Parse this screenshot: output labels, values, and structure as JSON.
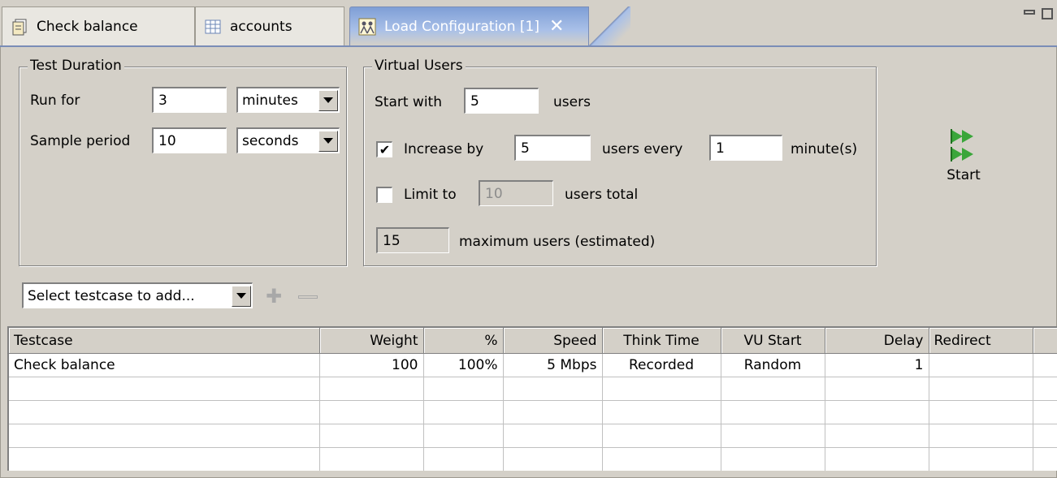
{
  "tabs": [
    {
      "label": "Check balance",
      "icon": "document-stack-icon"
    },
    {
      "label": "accounts",
      "icon": "table-grid-icon"
    },
    {
      "label": "Load Configuration [1]",
      "icon": "users-group-icon",
      "active": true
    }
  ],
  "test_duration": {
    "title": "Test Duration",
    "run_for_label": "Run for",
    "run_for_value": "3",
    "run_for_unit": "minutes",
    "sample_period_label": "Sample period",
    "sample_period_value": "10",
    "sample_period_unit": "seconds"
  },
  "virtual_users": {
    "title": "Virtual Users",
    "start_with_label": "Start with",
    "start_with_value": "5",
    "start_with_suffix": "users",
    "increase_checked": true,
    "increase_label": "Increase by",
    "increase_value": "5",
    "increase_mid": "users every",
    "increase_interval": "1",
    "increase_suffix": "minute(s)",
    "limit_checked": false,
    "limit_label": "Limit to",
    "limit_value": "10",
    "limit_suffix": "users total",
    "max_value": "15",
    "max_suffix": "maximum users (estimated)"
  },
  "start_button": {
    "label": "Start",
    "icon": "run-start-icon"
  },
  "testcase_select": {
    "placeholder": "Select testcase to add..."
  },
  "table": {
    "columns": [
      "Testcase",
      "Weight",
      "%",
      "Speed",
      "Think Time",
      "VU Start",
      "Delay",
      "Redirect"
    ],
    "rows": [
      [
        "Check balance",
        "100",
        "100%",
        "5 Mbps",
        "Recorded",
        "Random",
        "1",
        ""
      ]
    ]
  },
  "colors": {
    "active_tab": "#7f9fd6",
    "panel_bg": "#d4d0c8",
    "start_icon": "#3aa63a"
  }
}
